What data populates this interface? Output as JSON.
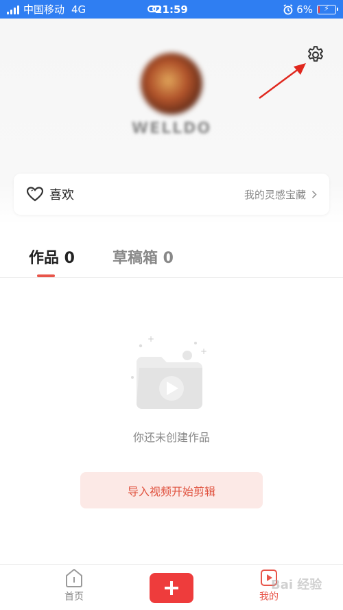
{
  "status_bar": {
    "carrier": "中国移动",
    "network": "4G",
    "time": "21:59",
    "battery_percent": "6%",
    "battery_level": 0.06
  },
  "profile": {
    "username": "WELLDO"
  },
  "like_card": {
    "label": "喜欢",
    "link_text": "我的灵感宝藏"
  },
  "tabs": [
    {
      "label": "作品 0"
    },
    {
      "label": "草稿箱 0"
    }
  ],
  "empty_state": {
    "message": "你还未创建作品",
    "button_label": "导入视频开始剪辑"
  },
  "bottom_nav": {
    "home_label": "首页",
    "mine_label": "我的"
  },
  "watermark": "Bai 经验",
  "colors": {
    "accent": "#e8554a",
    "add_button": "#ee3c3c",
    "status_bar": "#2f7ef2"
  }
}
